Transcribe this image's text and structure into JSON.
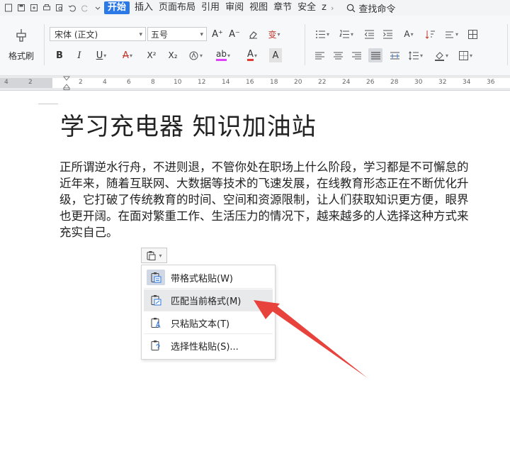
{
  "menu": {
    "tabs": [
      "开始",
      "插入",
      "页面布局",
      "引用",
      "审阅",
      "视图",
      "章节",
      "安全",
      "z"
    ],
    "active_tab": "开始",
    "more": "›",
    "search_command": "查找命令"
  },
  "ribbon": {
    "format_painter": "格式刷",
    "font_name": "宋体 (正文)",
    "font_size": "五号",
    "bold": "B",
    "italic": "I",
    "underline": "U",
    "strike": "A",
    "superscript": "X²",
    "subscript": "X₂",
    "font_color": "A",
    "char_shade": "A",
    "grow": "A⁺",
    "shrink": "A⁻",
    "highlight": "ab",
    "pinyin": "变"
  },
  "ruler": {
    "labels": [
      "4",
      "2",
      "2",
      "4",
      "6",
      "8",
      "10",
      "12",
      "14",
      "16",
      "18",
      "20",
      "22",
      "24",
      "26",
      "28",
      "30",
      "32",
      "34",
      "36"
    ]
  },
  "document": {
    "title": "学习充电器 知识加油站",
    "lines": [
      "正所谓逆水行舟，不进则退，不管你处在职场上什么阶段，学习都是不可懈怠的",
      "近年来，随着互联网、大数据等技术的飞速发展，在线教育形态正在不断优化升",
      "级，它打破了传统教育的时间、空间和资源限制，让人们获取知识更方便，眼界",
      "也更开阔。在面对繁重工作、生活压力的情况下，越来越多的人选择这种方式来",
      "充实自己。"
    ]
  },
  "paste_menu": {
    "items": [
      "带格式粘贴(W)",
      "匹配当前格式(M)",
      "只粘贴文本(T)",
      "选择性粘贴(S)..."
    ],
    "hovered_index": 1
  },
  "colors": {
    "accent": "#2b79e6",
    "arrow": "#e8423c",
    "menu_hover": "#e8e9eb"
  }
}
